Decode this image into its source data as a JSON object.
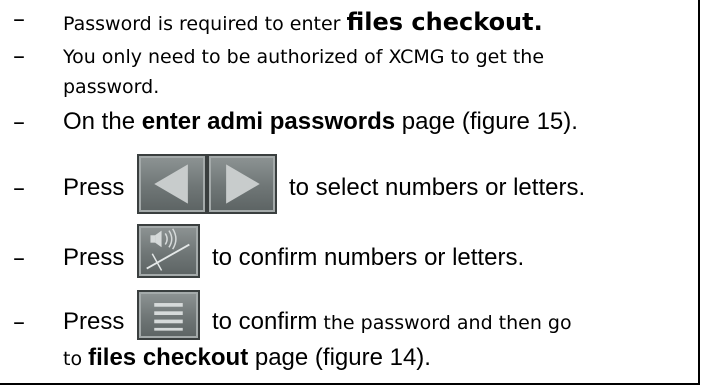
{
  "items": [
    {
      "dash": "–",
      "pre": "Password is required to enter ",
      "bold": "files checkout.",
      "post": ""
    },
    {
      "dash": "–",
      "line1": "You only need to be authorized of XCMG to get the",
      "line2": "password."
    },
    {
      "dash": "–",
      "pre": "On the ",
      "bold": "enter admi passwords",
      "post": " page (figure 15)."
    },
    {
      "dash": "–",
      "pre": "Press",
      "post": "to select numbers or letters."
    },
    {
      "dash": "–",
      "pre": "Press",
      "post": "to confirm numbers or letters."
    },
    {
      "dash": "–",
      "pre": "Press",
      "post_a": "to confirm",
      "post_b": " the password and then go",
      "line2_pre": "to ",
      "line2_bold": "files checkout",
      "line2_post": " page (figure 14)."
    }
  ],
  "icons": {
    "left": "left-arrow-icon",
    "right": "right-arrow-icon",
    "confirm_char": "sound-confirm-icon",
    "confirm_password": "menu-lines-icon"
  },
  "colors": {
    "button_face": "#6f7676",
    "button_border": "#3a3f3f",
    "glyph": "#c8cccc"
  }
}
